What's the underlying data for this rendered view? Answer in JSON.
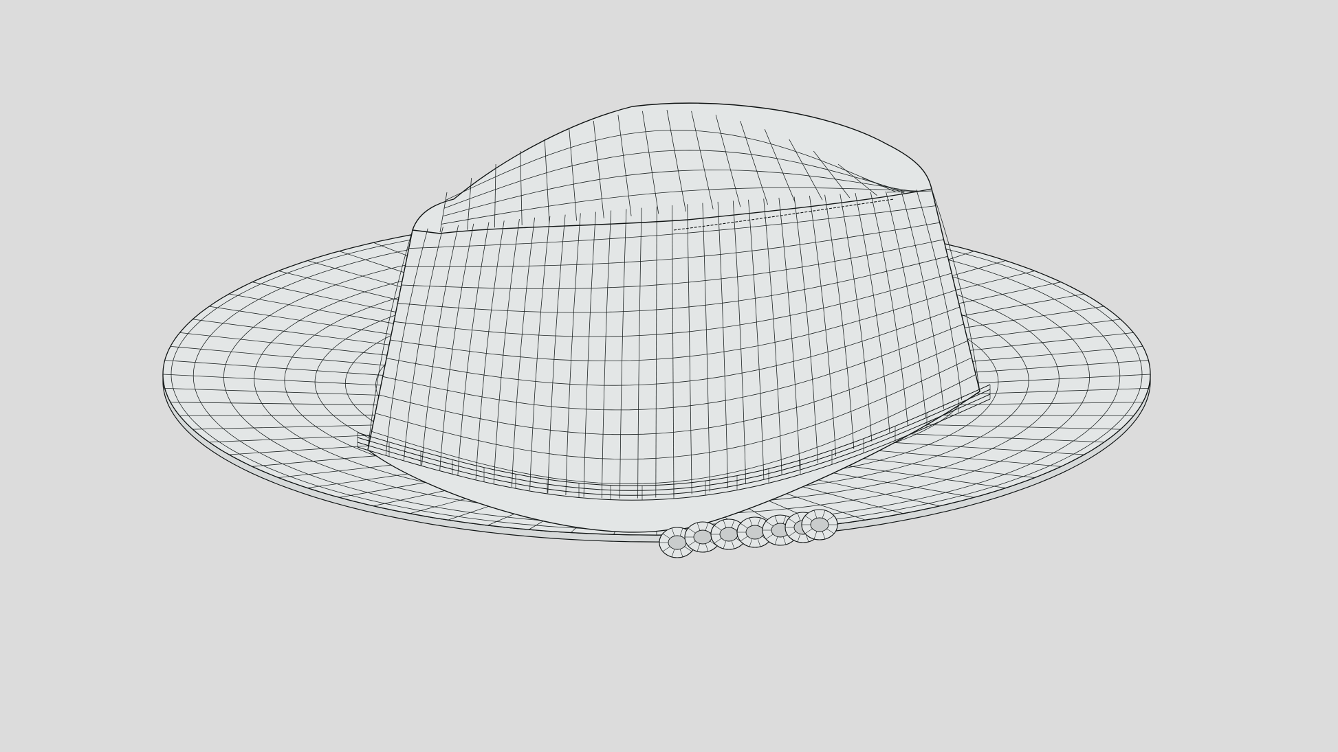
{
  "scene": {
    "subject": "wireframe-hat-model",
    "render_mode": "wireframe",
    "colors": {
      "background": "#dcdcdc",
      "surface": "#e3e6e6",
      "wire": "#1c2222",
      "edge": "#101414"
    }
  }
}
